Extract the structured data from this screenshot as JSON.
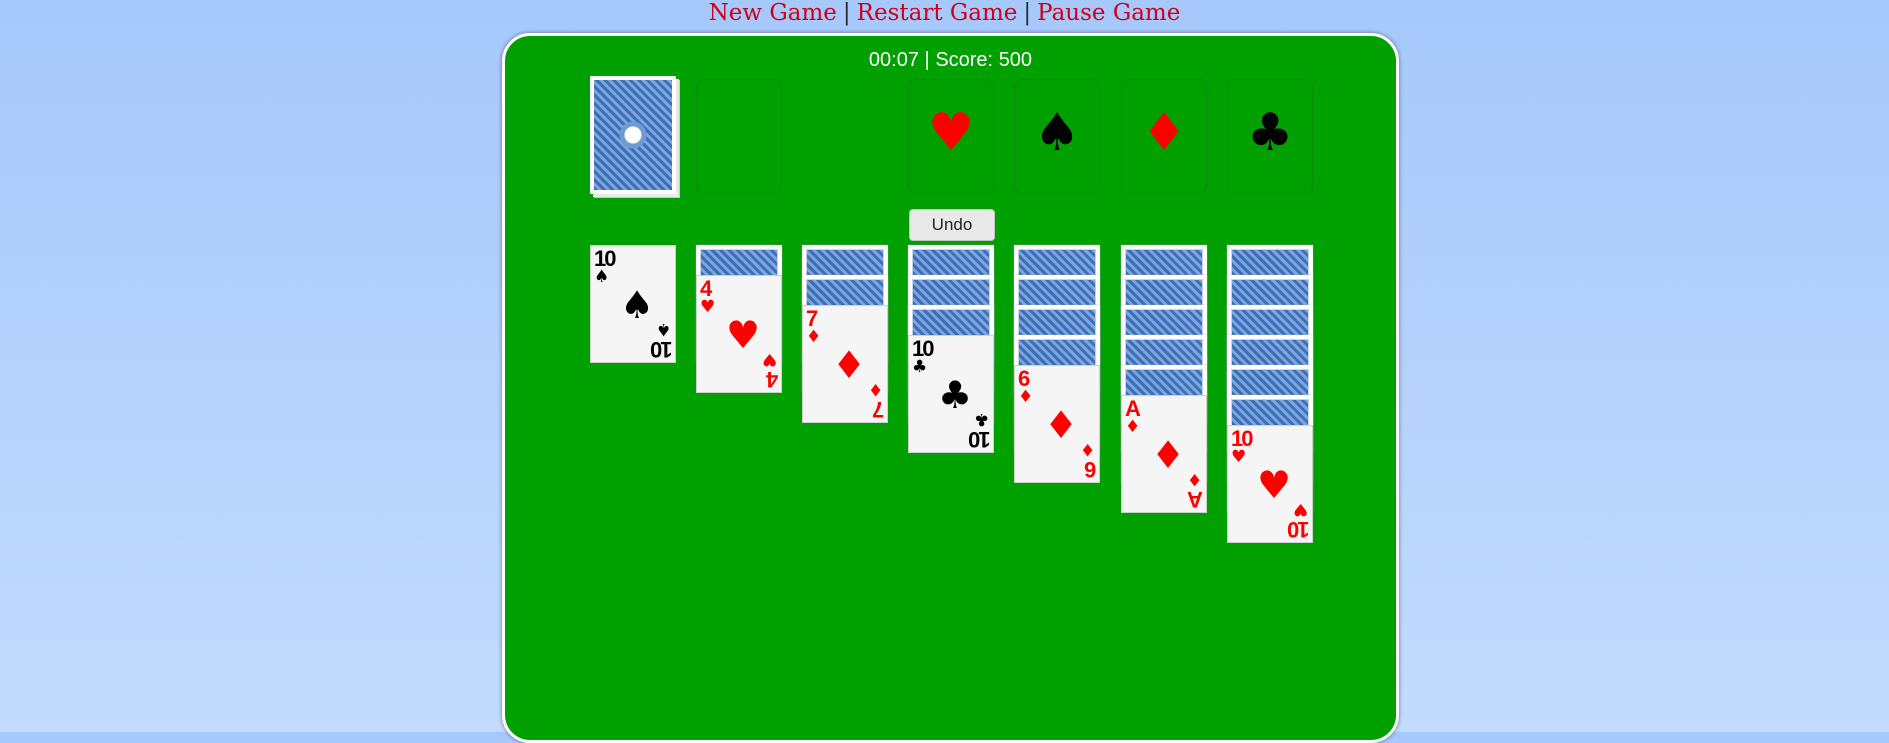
{
  "menu": {
    "new_game": "New Game",
    "separator": "|",
    "restart_game": "Restart Game",
    "pause_game": "Pause Game"
  },
  "status": {
    "time": "00:07",
    "separator": "|",
    "score_label": "Score:",
    "score": "500",
    "full": "00:07 | Score: 500"
  },
  "undo_label": "Undo",
  "colors": {
    "table": "#00a000",
    "background": "#a6c8fb",
    "menu_link": "#cc0019",
    "red_suit": "#ff0000",
    "black_suit": "#000000"
  },
  "stock": {
    "icon": "card-back"
  },
  "waste": {
    "cards": []
  },
  "foundations": [
    {
      "suit": "hearts",
      "symbol": "♥",
      "color": "red"
    },
    {
      "suit": "spades",
      "symbol": "♠",
      "color": "black"
    },
    {
      "suit": "diamonds",
      "symbol": "♦",
      "color": "red"
    },
    {
      "suit": "clubs",
      "symbol": "♣",
      "color": "black"
    }
  ],
  "tableau": [
    {
      "face_down": 0,
      "face_up": [
        {
          "rank": "10",
          "suit": "♠",
          "color": "black"
        }
      ]
    },
    {
      "face_down": 1,
      "face_up": [
        {
          "rank": "4",
          "suit": "♥",
          "color": "red"
        }
      ]
    },
    {
      "face_down": 2,
      "face_up": [
        {
          "rank": "7",
          "suit": "♦",
          "color": "red"
        }
      ]
    },
    {
      "face_down": 3,
      "face_up": [
        {
          "rank": "10",
          "suit": "♣",
          "color": "black"
        }
      ]
    },
    {
      "face_down": 4,
      "face_up": [
        {
          "rank": "6",
          "suit": "♦",
          "color": "red"
        }
      ]
    },
    {
      "face_down": 5,
      "face_up": [
        {
          "rank": "A",
          "suit": "♦",
          "color": "red"
        }
      ]
    },
    {
      "face_down": 6,
      "face_up": [
        {
          "rank": "10",
          "suit": "♥",
          "color": "red"
        }
      ]
    }
  ]
}
